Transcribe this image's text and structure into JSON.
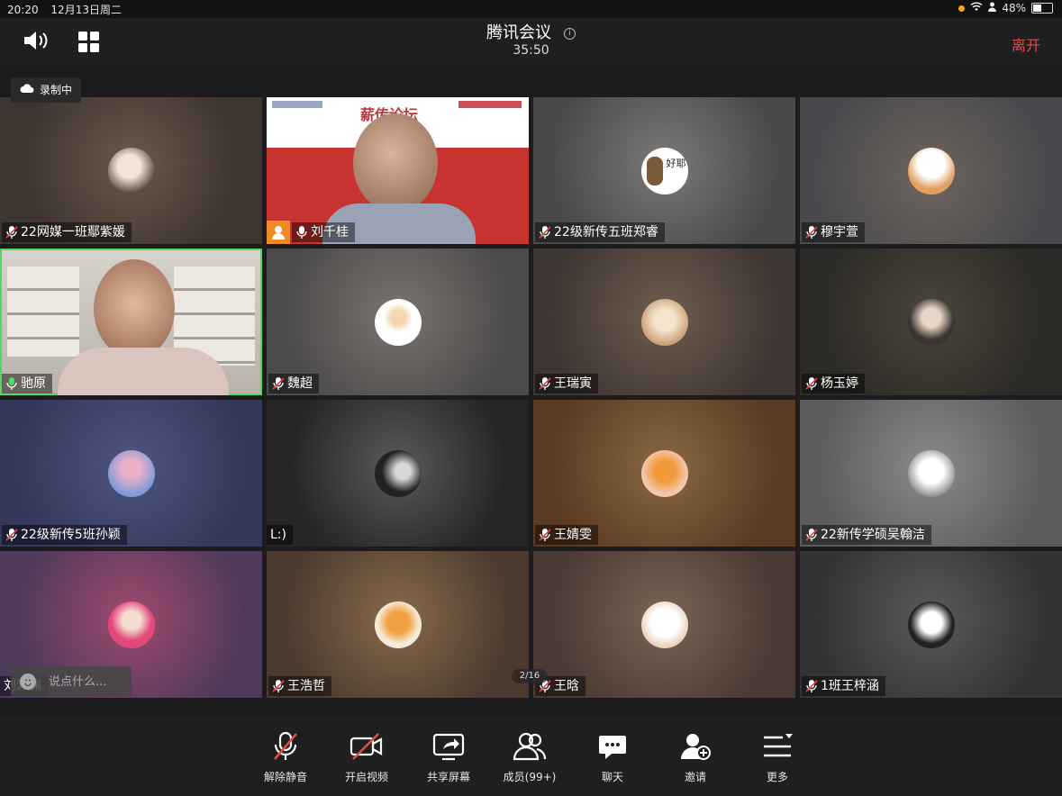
{
  "status": {
    "time": "20:20",
    "date": "12月13日周二",
    "battery": "48%",
    "battery_level": 0.48
  },
  "header": {
    "title": "腾讯会议",
    "timer": "35:50",
    "leave_label": "离开"
  },
  "recording": {
    "label": "录制中"
  },
  "participants": [
    {
      "name": "22网媒一班鄢紫媛"
    },
    {
      "name": "刘千桂"
    },
    {
      "name": "22级新传五班郑睿"
    },
    {
      "name": "穆宇萱"
    },
    {
      "name": "驰原"
    },
    {
      "name": "魏超"
    },
    {
      "name": "王瑞寅"
    },
    {
      "name": "杨玉婷"
    },
    {
      "name": "22级新传5班孙颖"
    },
    {
      "name": "L:)"
    },
    {
      "name": "王婧雯"
    },
    {
      "name": "22新传学硕吴翰洁"
    },
    {
      "name": "刘渊渊"
    },
    {
      "name": "王浩哲"
    },
    {
      "name": "王晗"
    },
    {
      "name": "1班王梓涵"
    }
  ],
  "slide": {
    "title": "薪传论坛"
  },
  "avatar_text": "好耶",
  "chat": {
    "placeholder": "说点什么..."
  },
  "pagination": {
    "label": "2/16"
  },
  "toolbar": {
    "unmute": "解除静音",
    "start_video": "开启视频",
    "share_screen": "共享屏幕",
    "members": "成员(99+)",
    "chat": "聊天",
    "invite": "邀请",
    "more": "更多"
  },
  "colors": {
    "leave": "#e24a4a",
    "active_speaker_border": "#4cd964",
    "mic_muted": "#e24a4a"
  }
}
